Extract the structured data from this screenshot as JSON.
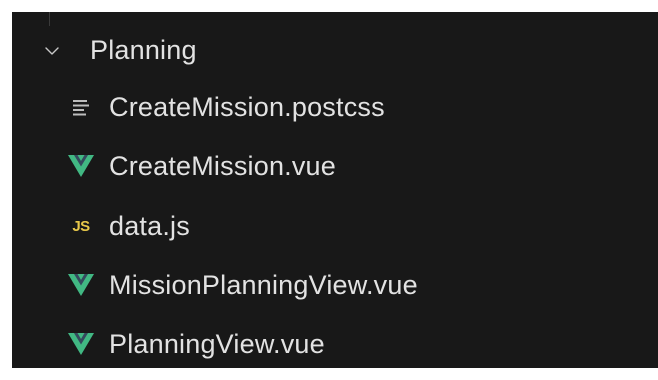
{
  "explorer": {
    "folder": {
      "label": "Planning",
      "icon": "chevron-down-icon",
      "expanded": true
    },
    "files": [
      {
        "label": "CreateMission.postcss",
        "icon": "text-lines-icon",
        "icon_color": "#bdbdbd"
      },
      {
        "label": "CreateMission.vue",
        "icon": "vue-icon",
        "icon_color": "#41b883"
      },
      {
        "label": "data.js",
        "icon": "js-icon",
        "icon_text": "JS",
        "icon_color": "#e8c84a"
      },
      {
        "label": "MissionPlanningView.vue",
        "icon": "vue-icon",
        "icon_color": "#41b883"
      },
      {
        "label": "PlanningView.vue",
        "icon": "vue-icon",
        "icon_color": "#41b883"
      }
    ]
  },
  "colors": {
    "background": "#181818",
    "text": "#e2e2e2"
  }
}
